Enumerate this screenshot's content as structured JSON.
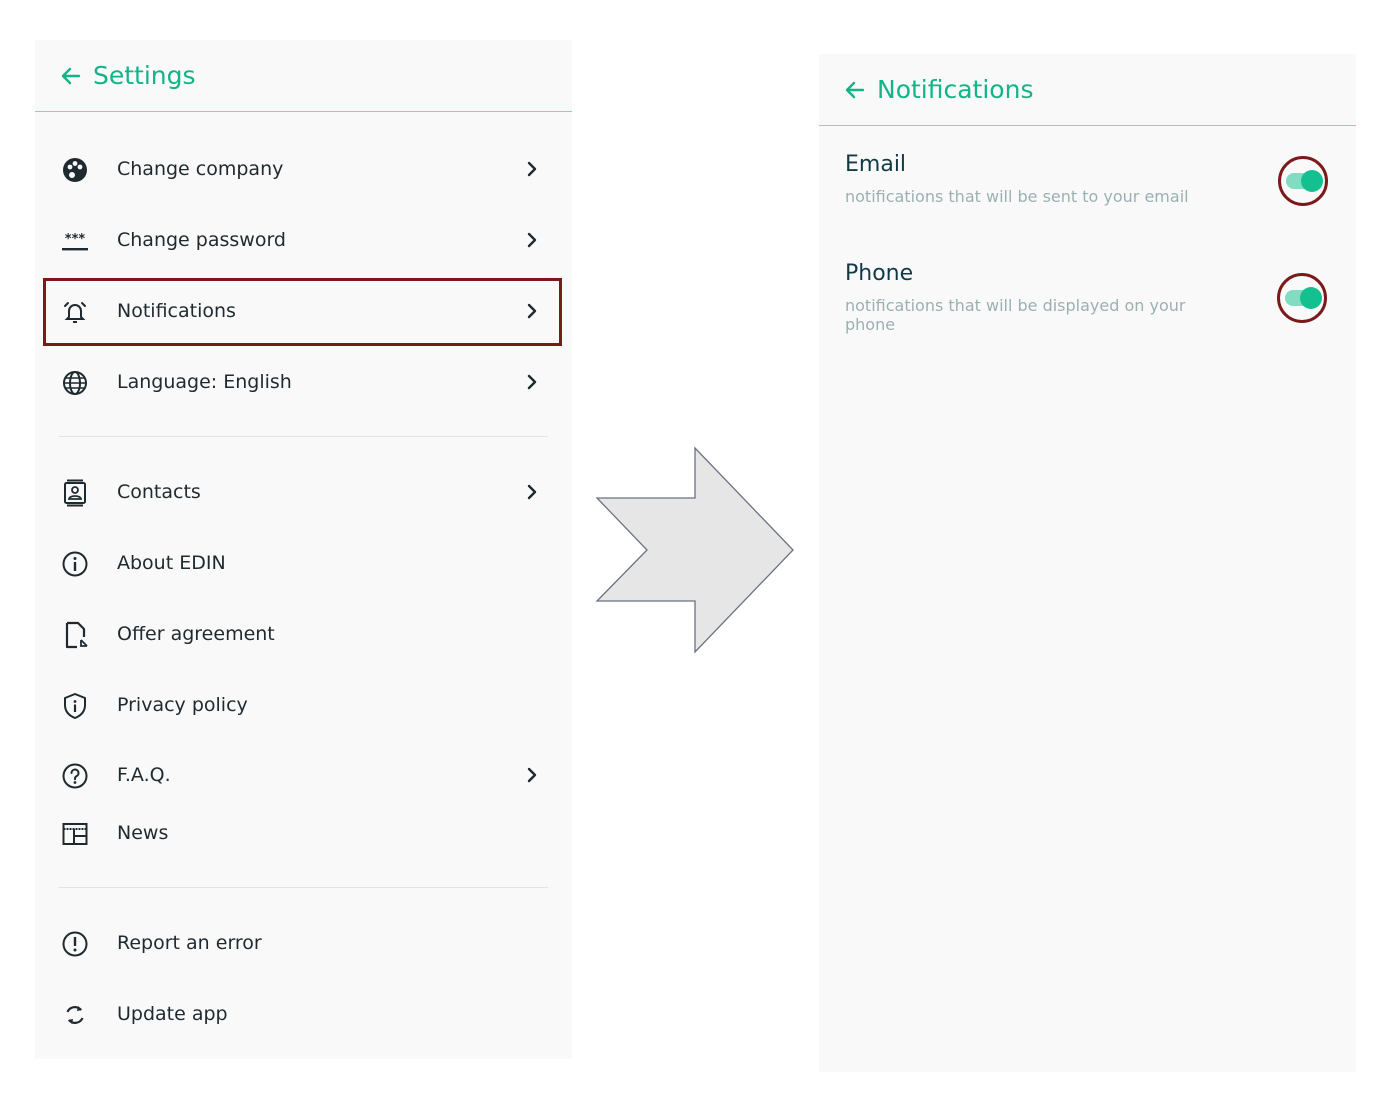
{
  "settings": {
    "title": "Settings",
    "items": [
      {
        "label": "Change company",
        "icon": "palette-icon",
        "chevron": true
      },
      {
        "label": "Change password",
        "icon": "password-icon",
        "chevron": true
      },
      {
        "label": "Notifications",
        "icon": "alarm-bell-icon",
        "chevron": true
      },
      {
        "label": "Language: English",
        "icon": "globe-icon",
        "chevron": true
      },
      {
        "label": "Contacts",
        "icon": "contacts-icon",
        "chevron": true
      },
      {
        "label": "About EDIN",
        "icon": "info-icon",
        "chevron": false
      },
      {
        "label": "Offer agreement",
        "icon": "document-link-icon",
        "chevron": false
      },
      {
        "label": "Privacy policy",
        "icon": "shield-info-icon",
        "chevron": false
      },
      {
        "label": "F.A.Q.",
        "icon": "help-circle-icon",
        "chevron": true
      },
      {
        "label": "News",
        "icon": "newspaper-icon",
        "chevron": false
      },
      {
        "label": "Report an error",
        "icon": "alert-circle-icon",
        "chevron": false
      },
      {
        "label": "Update app",
        "icon": "sync-icon",
        "chevron": false
      }
    ]
  },
  "notifications": {
    "title": "Notifications",
    "options": [
      {
        "title": "Email",
        "description": "notifications that will be sent to your email",
        "enabled": true
      },
      {
        "title": "Phone",
        "description": "notifications that will be displayed on your phone",
        "enabled": true
      }
    ]
  },
  "colors": {
    "accent": "#12b488",
    "highlight": "#7a1a1a",
    "panel": "#f9f9f9"
  }
}
